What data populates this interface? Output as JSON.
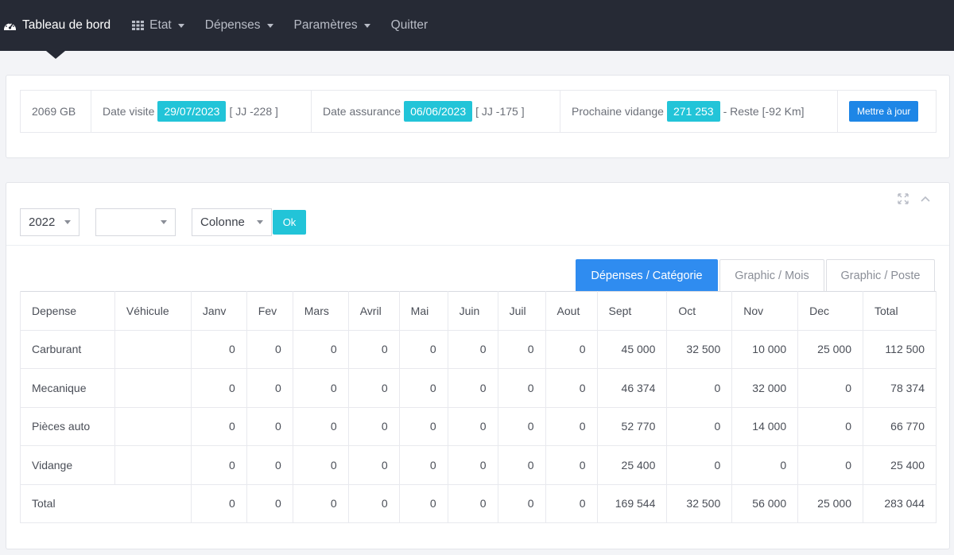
{
  "nav": {
    "brand": "Tableau de bord",
    "items": [
      {
        "label": "Etat",
        "icon": "grid-icon",
        "dropdown": true
      },
      {
        "label": "Dépenses",
        "dropdown": true
      },
      {
        "label": "Paramètres",
        "dropdown": true
      },
      {
        "label": "Quitter",
        "dropdown": false
      }
    ]
  },
  "info": {
    "vehicle": "2069 GB",
    "visit_label": "Date visite",
    "visit_date": "29/07/2023",
    "visit_days": "[ JJ -228 ]",
    "insurance_label": "Date assurance",
    "insurance_date": "06/06/2023",
    "insurance_days": "[ JJ -175 ]",
    "oil_label": "Prochaine vidange",
    "oil_km": "271 253",
    "oil_rest": "- Reste [-92 Km]",
    "update_button": "Mettre à jour"
  },
  "filters": {
    "year": "2022",
    "second": "",
    "chart_type": "Colonne",
    "ok": "Ok"
  },
  "tabs": [
    "Dépenses / Catégorie",
    "Graphic / Mois",
    "Graphic / Poste"
  ],
  "table": {
    "headers": [
      "Depense",
      "Véhicule",
      "Janv",
      "Fev",
      "Mars",
      "Avril",
      "Mai",
      "Juin",
      "Juil",
      "Aout",
      "Sept",
      "Oct",
      "Nov",
      "Dec",
      "Total"
    ],
    "rows": [
      {
        "label": "Carburant",
        "vehicle": "",
        "values": [
          "0",
          "0",
          "0",
          "0",
          "0",
          "0",
          "0",
          "0",
          "45 000",
          "32 500",
          "10 000",
          "25 000",
          "112 500"
        ]
      },
      {
        "label": "Mecanique",
        "vehicle": "",
        "values": [
          "0",
          "0",
          "0",
          "0",
          "0",
          "0",
          "0",
          "0",
          "46 374",
          "0",
          "32 000",
          "0",
          "78 374"
        ]
      },
      {
        "label": "Pièces auto",
        "vehicle": "",
        "values": [
          "0",
          "0",
          "0",
          "0",
          "0",
          "0",
          "0",
          "0",
          "52 770",
          "0",
          "14 000",
          "0",
          "66 770"
        ]
      },
      {
        "label": "Vidange",
        "vehicle": "",
        "values": [
          "0",
          "0",
          "0",
          "0",
          "0",
          "0",
          "0",
          "0",
          "25 400",
          "0",
          "0",
          "0",
          "25 400"
        ]
      }
    ],
    "total": {
      "label": "Total",
      "values": [
        "0",
        "0",
        "0",
        "0",
        "0",
        "0",
        "0",
        "0",
        "169 544",
        "32 500",
        "56 000",
        "25 000",
        "283 044"
      ]
    }
  },
  "colors": {
    "nav_bg": "#262a35",
    "accent_cyan": "#22c4d8",
    "accent_blue": "#2f8cf0",
    "update_button": "#1e86e6"
  }
}
